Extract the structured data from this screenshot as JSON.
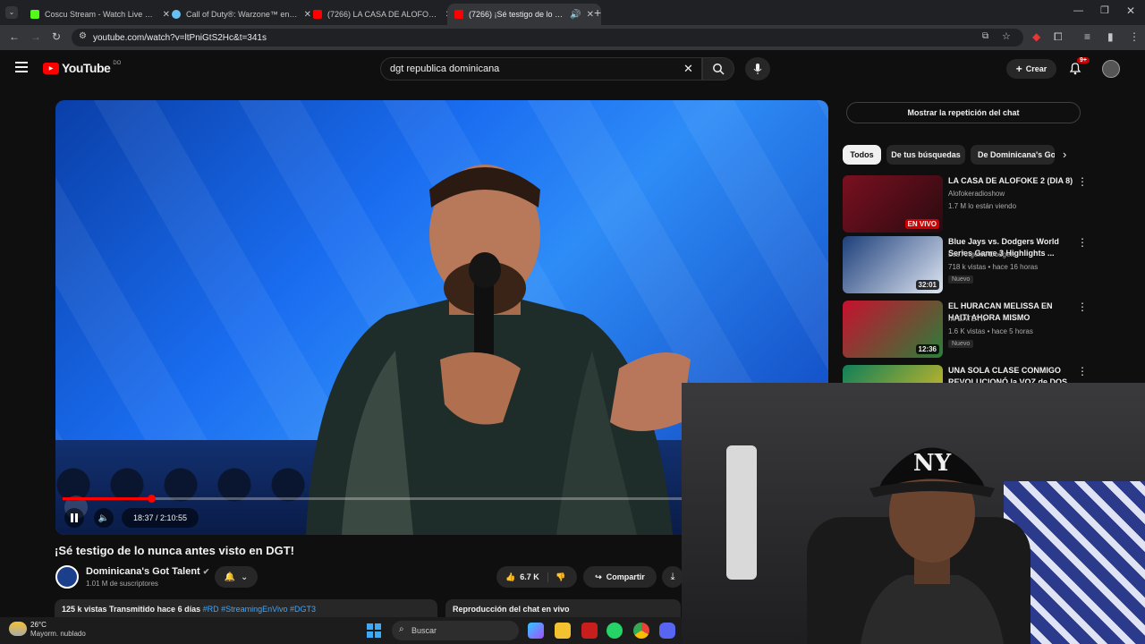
{
  "browser": {
    "tabs": [
      {
        "title": "Coscu Stream - Watch Live on Kick",
        "color": "#53fc18"
      },
      {
        "title": "Call of Duty®: Warzone™ en Steam",
        "color": "#66c0f4"
      },
      {
        "title": "(7266) LA CASA DE ALOFOKE 2",
        "color": "#ff0000"
      },
      {
        "title": "(7266) ¡Sé testigo de lo nunca antes visto en DGT!",
        "color": "#ff0000"
      }
    ],
    "url": "youtube.com/watch?v=ltPniGtS2Hc&t=341s"
  },
  "youtube": {
    "logo_text": "YouTube",
    "region": "DO",
    "search_value": "dgt republica dominicana",
    "create_label": "Crear",
    "notif_badge": "9+"
  },
  "player": {
    "time": "18:37 / 2:10:55",
    "progress_fraction": 0.142
  },
  "video": {
    "title": "¡Sé testigo de lo nunca antes visto en DGT!",
    "channel": "Dominicana's Got Talent",
    "subscribers": "1.01 M de suscriptores",
    "likes": "6.7 K",
    "share_label": "Compartir",
    "views_line": "125 k vistas  Transmitido hace 6 días",
    "tags": "#RD #StreamingEnVivo #DGT3",
    "chat_replay_label": "Reproducción del chat en vivo"
  },
  "sidebar": {
    "chat_button": "Mostrar la repetición del chat",
    "chips": [
      "Todos",
      "De tus búsquedas",
      "De Dominicana's Got Talent"
    ],
    "recommendations": [
      {
        "title": "LA CASA DE ALOFOKE 2 (DIA 8)",
        "channel": "Alofokeradioshow",
        "meta": "1.7 M lo están viendo",
        "badge": "EN VIVO",
        "color1": "#7a1020",
        "color2": "#2a0a10"
      },
      {
        "title": "Blue Jays vs. Dodgers World Series Game 3 Highlights ...",
        "channel": "Los Angeles Dodgers",
        "meta": "718 k vistas • hace 16 horas",
        "badge": "32:01",
        "new": "Nuevo",
        "color1": "#1d3f7a",
        "color2": "#dfe6f2"
      },
      {
        "title": "EL HURACAN MELISSA  EN HAITI AHORA MISMO",
        "channel": "mi BATEYtv",
        "meta": "1.6 K vistas • hace 5 horas",
        "badge": "12:36",
        "new": "Nuevo",
        "color1": "#c8102e",
        "color2": "#2a7f3a"
      },
      {
        "title": "UNA SOLA CLASE CONMIGO REVOLUCIONÓ la VOZ de DOS",
        "channel": "",
        "meta": "",
        "badge": "",
        "color1": "#0e7f5a",
        "color2": "#e8c020"
      }
    ]
  },
  "taskbar": {
    "temp": "26°C",
    "weather": "Mayorm. nublado",
    "search_placeholder": "Buscar"
  }
}
